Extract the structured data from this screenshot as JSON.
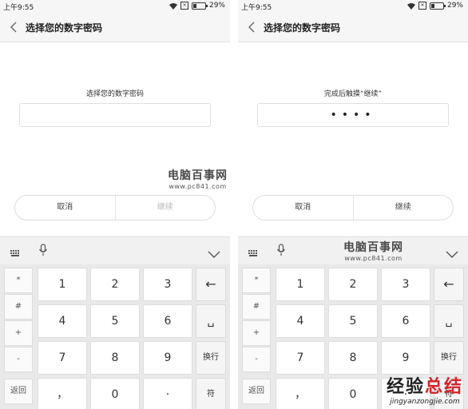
{
  "status": {
    "time": "上午9:55",
    "battery": "29%",
    "battery_level": 0.29
  },
  "screens": [
    {
      "title": "选择您的数字密码",
      "prompt": "选择您的数字密码",
      "pin_value": "",
      "cancel_label": "取消",
      "continue_label": "继续",
      "continue_enabled": false
    },
    {
      "title": "选择您的数字密码",
      "prompt": "完成后触摸“继续”",
      "pin_value": "••••",
      "cancel_label": "取消",
      "continue_label": "继续",
      "continue_enabled": true
    }
  ],
  "keyboard": {
    "side_keys": [
      "*",
      "#",
      "+",
      "-",
      "返回"
    ],
    "rows": [
      [
        "1",
        "2",
        "3"
      ],
      [
        "4",
        "5",
        "6"
      ],
      [
        "7",
        "8",
        "9"
      ],
      [
        "，",
        "0",
        "·"
      ]
    ],
    "function_keys": {
      "backspace": "←",
      "space": "␣",
      "enter": "换行",
      "symbol": "符"
    },
    "toolbar_icons": [
      "keyboard-grid-icon",
      "microphone-icon",
      "chevron-down-icon"
    ]
  },
  "watermarks": {
    "site_title": "电脑百事网",
    "site_url": "www.pc841.com",
    "corner_title_a": "经验",
    "corner_title_b": "总结",
    "corner_url": "jingyanzongjie.com"
  }
}
